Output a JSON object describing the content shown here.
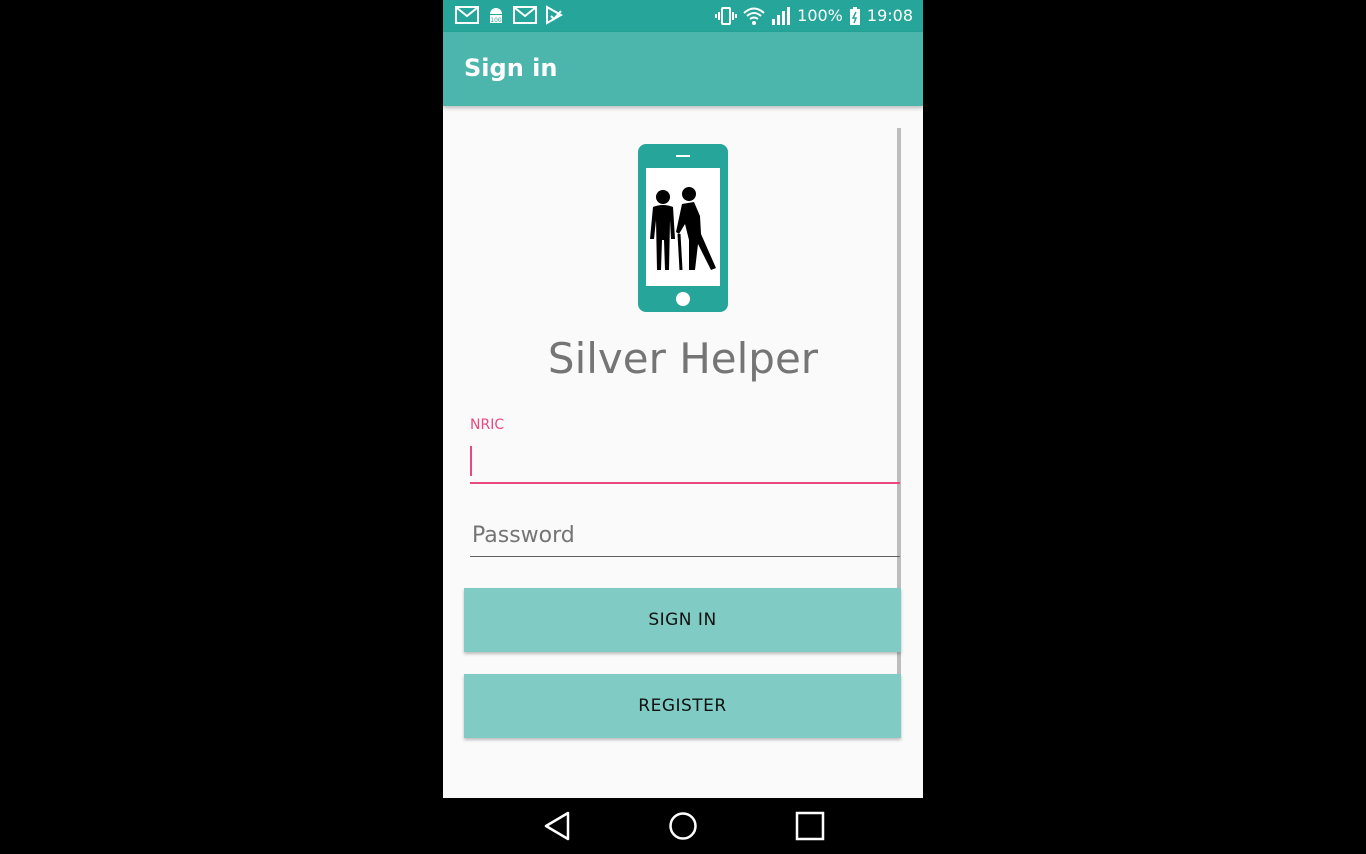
{
  "status_bar": {
    "icons_left": [
      "gmail-icon",
      "android-debug-icon",
      "gmail-icon",
      "play-store-icon"
    ],
    "battery": "100%",
    "time": "19:08",
    "icons_right": [
      "vibrate-icon",
      "wifi-icon",
      "signal-icon",
      "battery-charging-icon"
    ]
  },
  "app_bar": {
    "title": "Sign in"
  },
  "logo": {
    "icon": "elderly-phone-logo-icon",
    "color": "#26a69a"
  },
  "app_name": "Silver Helper",
  "form": {
    "nric_label": "NRIC",
    "nric_value": "",
    "password_placeholder": "Password",
    "password_value": ""
  },
  "buttons": {
    "sign_in": "SIGN IN",
    "register": "REGISTER"
  },
  "nav": {
    "back": "back-icon",
    "home": "home-icon",
    "recents": "recents-icon"
  },
  "colors": {
    "primary_dark": "#26a69a",
    "primary": "#4db6ac",
    "accent": "#e84a7f",
    "button": "#80cbc4"
  }
}
